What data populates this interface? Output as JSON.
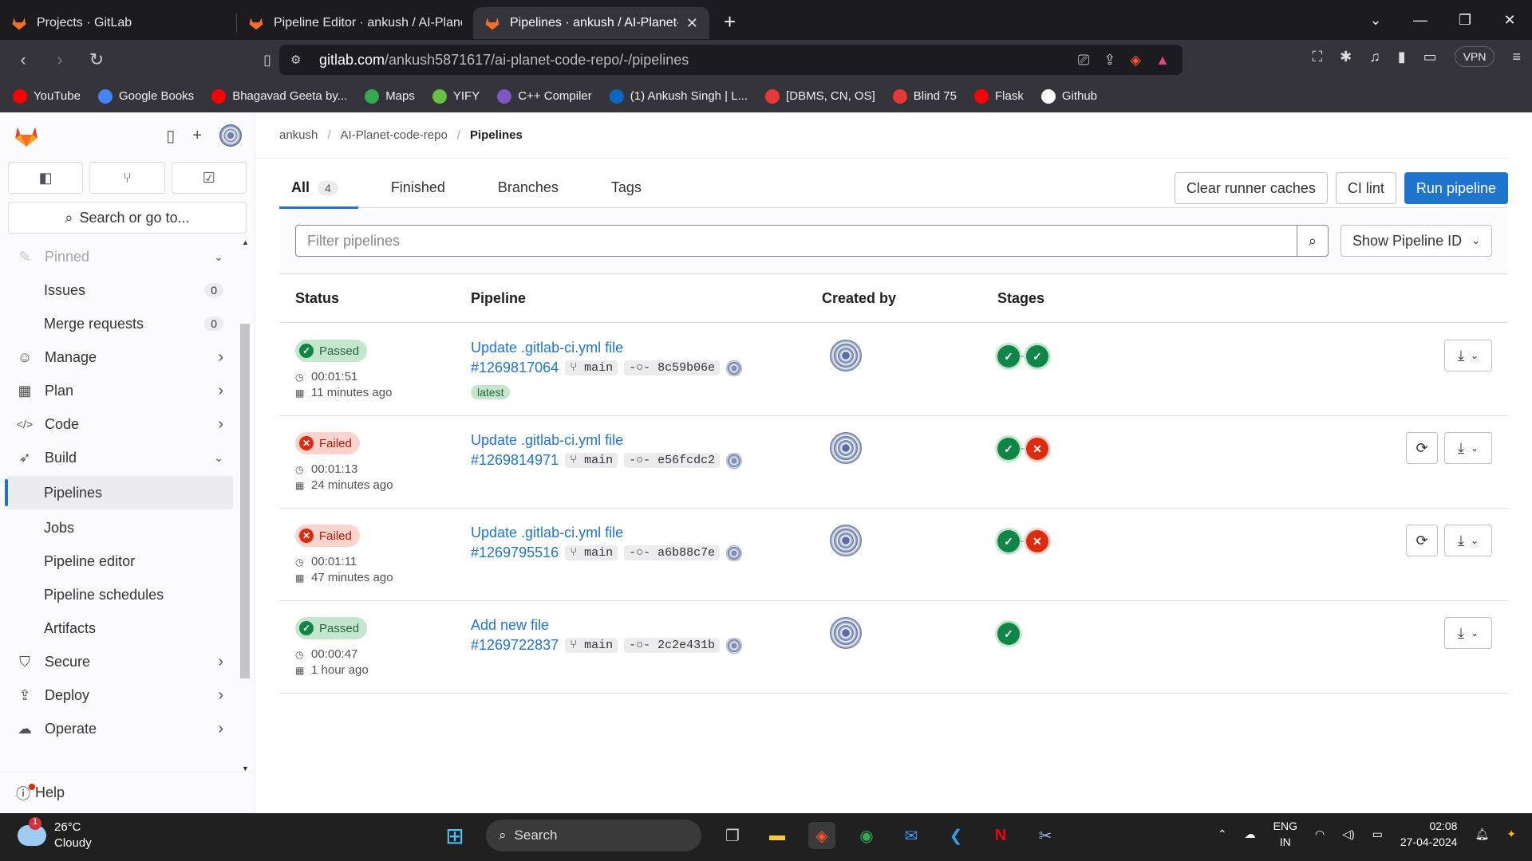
{
  "browser": {
    "tabs": [
      {
        "title": "Projects · GitLab",
        "active": false
      },
      {
        "title": "Pipeline Editor · ankush / AI-Planet-co",
        "active": false
      },
      {
        "title": "Pipelines · ankush / AI-Planet-co",
        "active": true
      }
    ],
    "url_host": "gitlab.com",
    "url_path": "/ankush5871617/ai-planet-code-repo/-/pipelines",
    "vpn_label": "VPN",
    "bookmarks": [
      {
        "label": "YouTube",
        "color": "#ff0000"
      },
      {
        "label": "Google Books",
        "color": "#4285f4"
      },
      {
        "label": "Bhagavad Geeta by...",
        "color": "#ff0000"
      },
      {
        "label": "Maps",
        "color": "#34a853"
      },
      {
        "label": "YIFY",
        "color": "#6ac045"
      },
      {
        "label": "C++ Compiler",
        "color": "#7e57c2"
      },
      {
        "label": "(1) Ankush Singh | L...",
        "color": "#0a66c2"
      },
      {
        "label": "[DBMS, CN, OS]",
        "color": "#e53935"
      },
      {
        "label": "Blind 75",
        "color": "#e53935"
      },
      {
        "label": "Flask",
        "color": "#ff0000"
      },
      {
        "label": "Github",
        "color": "#ffffff"
      }
    ]
  },
  "sidebar": {
    "search_label": "Search or go to...",
    "items": [
      {
        "label": "Pinned",
        "type": "section-muted"
      },
      {
        "label": "Issues",
        "type": "sub",
        "badge": "0"
      },
      {
        "label": "Merge requests",
        "type": "sub",
        "badge": "0"
      },
      {
        "label": "Manage",
        "type": "group",
        "icon": "users-icon"
      },
      {
        "label": "Plan",
        "type": "group",
        "icon": "calendar-icon"
      },
      {
        "label": "Code",
        "type": "group",
        "icon": "code-icon"
      },
      {
        "label": "Build",
        "type": "group-open",
        "icon": "rocket-icon"
      },
      {
        "label": "Pipelines",
        "type": "active"
      },
      {
        "label": "Jobs",
        "type": "sub"
      },
      {
        "label": "Pipeline editor",
        "type": "sub"
      },
      {
        "label": "Pipeline schedules",
        "type": "sub"
      },
      {
        "label": "Artifacts",
        "type": "sub"
      },
      {
        "label": "Secure",
        "type": "group",
        "icon": "shield-icon"
      },
      {
        "label": "Deploy",
        "type": "group",
        "icon": "deploy-icon"
      },
      {
        "label": "Operate",
        "type": "group",
        "icon": "cloud-icon"
      }
    ],
    "help_label": "Help"
  },
  "breadcrumb": [
    "ankush",
    "AI-Planet-code-repo",
    "Pipelines"
  ],
  "tabs": {
    "all_label": "All",
    "all_count": "4",
    "finished_label": "Finished",
    "branches_label": "Branches",
    "tags_label": "Tags"
  },
  "actions": {
    "clear_caches": "Clear runner caches",
    "ci_lint": "CI lint",
    "run_pipeline": "Run pipeline"
  },
  "filter": {
    "placeholder": "Filter pipelines",
    "show_id_label": "Show Pipeline ID"
  },
  "table": {
    "headers": {
      "status": "Status",
      "pipeline": "Pipeline",
      "created_by": "Created by",
      "stages": "Stages"
    },
    "rows": [
      {
        "status": "Passed",
        "duration": "00:01:51",
        "ago": "11 minutes ago",
        "title": "Update .gitlab-ci.yml file",
        "id": "#1269817064",
        "branch": "main",
        "sha": "8c59b06e",
        "latest": "latest",
        "stages": [
          "ok",
          "ok"
        ],
        "retry": false
      },
      {
        "status": "Failed",
        "duration": "00:01:13",
        "ago": "24 minutes ago",
        "title": "Update .gitlab-ci.yml file",
        "id": "#1269814971",
        "branch": "main",
        "sha": "e56fcdc2",
        "stages": [
          "ok",
          "bad"
        ],
        "retry": true
      },
      {
        "status": "Failed",
        "duration": "00:01:11",
        "ago": "47 minutes ago",
        "title": "Update .gitlab-ci.yml file",
        "id": "#1269795516",
        "branch": "main",
        "sha": "a6b88c7e",
        "stages": [
          "ok",
          "bad"
        ],
        "retry": true
      },
      {
        "status": "Passed",
        "duration": "00:00:47",
        "ago": "1 hour ago",
        "title": "Add new file",
        "id": "#1269722837",
        "branch": "main",
        "sha": "2c2e431b",
        "stages": [
          "ok"
        ],
        "retry": false
      }
    ]
  },
  "taskbar": {
    "temp": "26°C",
    "weather": "Cloudy",
    "weather_badge": "1",
    "search_label": "Search",
    "lang_1": "ENG",
    "lang_2": "IN",
    "time": "02:08",
    "date": "27-04-2024"
  },
  "colors": {
    "accent": "#1f75cb",
    "passed": "#108548",
    "failed": "#dd2b0e"
  }
}
